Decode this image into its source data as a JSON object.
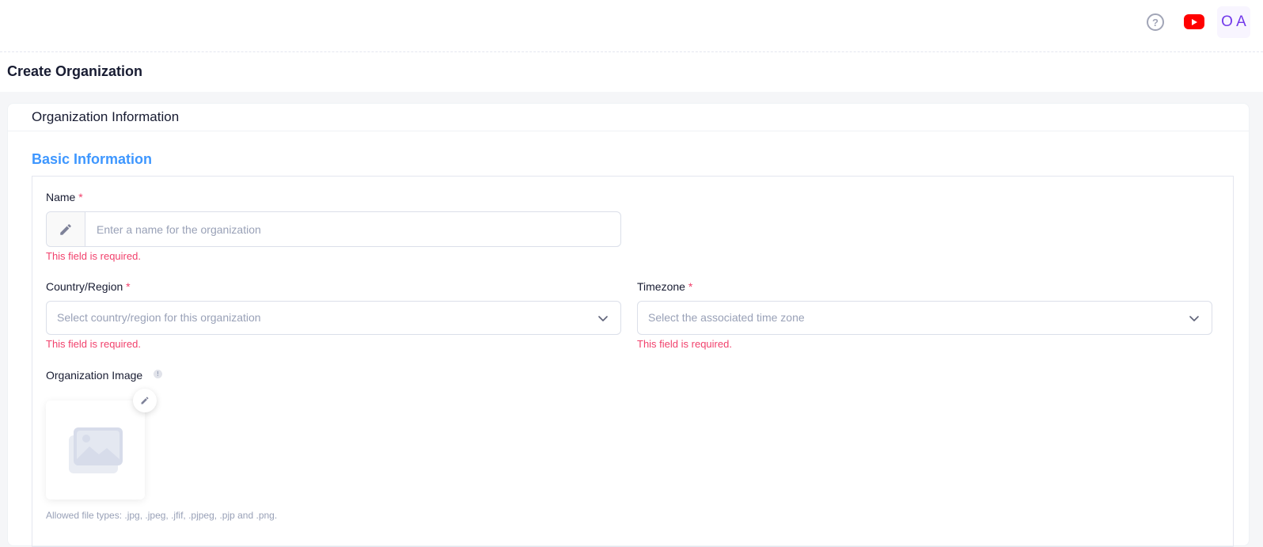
{
  "header": {
    "help_icon_text": "?",
    "avatar_initials": "O A"
  },
  "page": {
    "title": "Create Organization"
  },
  "card": {
    "title": "Organization Information",
    "section_title": "Basic Information"
  },
  "form": {
    "name": {
      "label": "Name",
      "required_mark": "*",
      "placeholder": "Enter a name for the organization",
      "value": "",
      "error": "This field is required."
    },
    "country": {
      "label": "Country/Region",
      "required_mark": "*",
      "placeholder": "Select country/region for this organization",
      "error": "This field is required."
    },
    "timezone": {
      "label": "Timezone",
      "required_mark": "*",
      "placeholder": "Select the associated time zone",
      "error": "This field is required."
    },
    "image": {
      "label": "Organization Image",
      "info_icon_text": "!",
      "hint": "Allowed file types: .jpg, .jpeg, .jfif, .pjpeg, .pjp and .png."
    }
  },
  "colors": {
    "accent": "#3e97ff",
    "error": "#f1416c",
    "youtube": "#ff0000",
    "avatar_text": "#7239ea"
  },
  "icons": {
    "help": "question-circle-icon",
    "youtube": "youtube-icon",
    "name_addon": "pencil-icon",
    "select_chevron": "chevron-down-icon",
    "image_placeholder": "image-icon",
    "image_edit": "pencil-icon",
    "info": "info-icon"
  }
}
